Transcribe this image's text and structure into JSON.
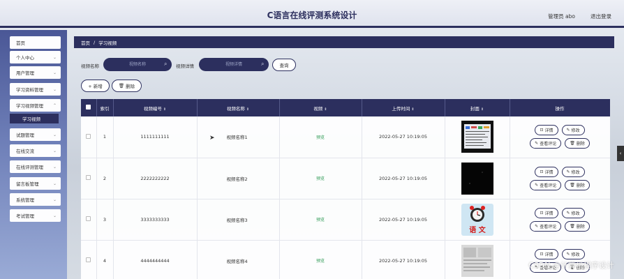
{
  "header": {
    "title": "C语言在线评测系统设计",
    "user": "管理员 abo",
    "logout": "退出登录"
  },
  "sidebar": {
    "items": [
      {
        "label": "首页",
        "chevron": false
      },
      {
        "label": "个人中心",
        "chevron": true
      },
      {
        "label": "用户管理",
        "chevron": true
      },
      {
        "label": "学习资料管理",
        "chevron": true
      },
      {
        "label": "学习视频管理",
        "chevron": true,
        "expanded": true
      },
      {
        "label": "试题管理",
        "chevron": true
      },
      {
        "label": "在线交流",
        "chevron": true
      },
      {
        "label": "在线评测管理",
        "chevron": true
      },
      {
        "label": "留言板管理",
        "chevron": true
      },
      {
        "label": "系统管理",
        "chevron": true
      },
      {
        "label": "考试管理",
        "chevron": true
      }
    ],
    "active_sub": "学习视频"
  },
  "breadcrumb": {
    "home": "首页",
    "sep": "/",
    "current": "学习视频"
  },
  "search": {
    "name_label": "视频名称",
    "name_placeholder": "视频名称",
    "detail_label": "视频详情",
    "detail_placeholder": "视频详情",
    "button": "查询"
  },
  "toolbar": {
    "add": "+ 新增",
    "delete": "删除"
  },
  "table": {
    "columns": [
      "",
      "索引",
      "视频编号",
      "视频名称",
      "视频",
      "上传时间",
      "封面",
      "操作"
    ],
    "rows": [
      {
        "index": "1",
        "code": "1111111111",
        "name": "视频名称1",
        "video": "预览",
        "time": "2022-05-27 10:19:05"
      },
      {
        "index": "2",
        "code": "2222222222",
        "name": "视频名称2",
        "video": "预览",
        "time": "2022-05-27 10:19:05"
      },
      {
        "index": "3",
        "code": "3333333333",
        "name": "视频名称3",
        "video": "预览",
        "time": "2022-05-27 10:19:05"
      },
      {
        "index": "4",
        "code": "4444444444",
        "name": "视频名称4",
        "video": "预览",
        "time": "2022-05-27 10:19:05"
      }
    ],
    "actions": {
      "detail": "详情",
      "edit": "修改",
      "comments": "查看评论",
      "delete": "删除"
    }
  },
  "cover3_text": "语 文",
  "watermark": "CSDN @计算机程序设计",
  "colors": {
    "primary": "#2c2f5e",
    "preview": "#2e9a55"
  }
}
